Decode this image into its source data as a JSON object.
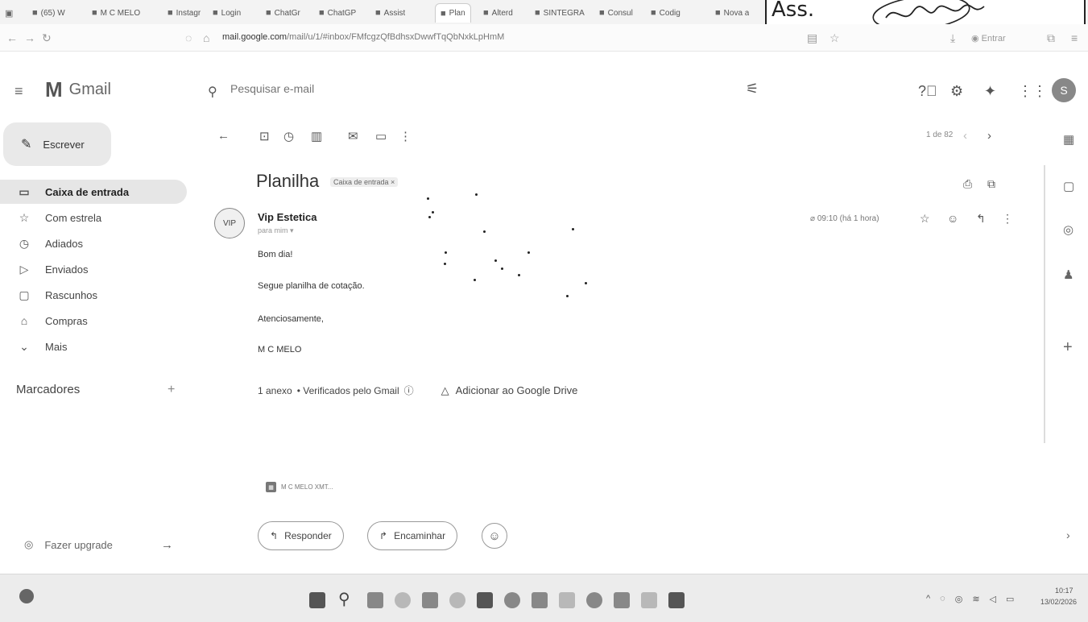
{
  "browser": {
    "tabs": [
      {
        "icon": "whatsapp-icon",
        "label": "(65) W"
      },
      {
        "icon": "page-icon",
        "label": "M C MELO"
      },
      {
        "icon": "instagram-icon",
        "label": "Instagr"
      },
      {
        "icon": "login-icon",
        "label": "Login"
      },
      {
        "icon": "chatgpt-icon",
        "label": "ChatGr"
      },
      {
        "icon": "chatgpt-icon",
        "label": "ChatGP"
      },
      {
        "icon": "assistant-icon",
        "label": "Assist"
      },
      {
        "icon": "gmail-icon",
        "label": "Plan"
      },
      {
        "icon": "page-icon",
        "label": "Alterd"
      },
      {
        "icon": "page-icon",
        "label": "SINTEGRA"
      },
      {
        "icon": "page-icon",
        "label": "Consul"
      },
      {
        "icon": "gmail-icon",
        "label": "Codig"
      },
      {
        "icon": "page-icon",
        "label": "Nova a"
      }
    ],
    "url_host": "mail.google.com",
    "url_path": "/mail/u/1/#inbox/FMfcgzQfBdhsxDwwfTqQbNxkLpHmM",
    "signin_label": "Entrar"
  },
  "stamp": {
    "label": "Ass."
  },
  "gmail": {
    "app_name": "Gmail",
    "search_placeholder": "Pesquisar e-mail",
    "avatar_letter": "S",
    "compose_label": "Escrever",
    "nav": [
      {
        "icon": "inbox-icon",
        "glyph": "▭",
        "label": "Caixa de entrada",
        "selected": true
      },
      {
        "icon": "star-icon",
        "glyph": "☆",
        "label": "Com estrela",
        "selected": false
      },
      {
        "icon": "clock-icon",
        "glyph": "◷",
        "label": "Adiados",
        "selected": false
      },
      {
        "icon": "send-icon",
        "glyph": "▷",
        "label": "Enviados",
        "selected": false
      },
      {
        "icon": "draft-icon",
        "glyph": "▢",
        "label": "Rascunhos",
        "selected": false
      },
      {
        "icon": "shopping-icon",
        "glyph": "⌂",
        "label": "Compras",
        "selected": false
      },
      {
        "icon": "chevron-down-icon",
        "glyph": "⌄",
        "label": "Mais",
        "selected": false
      }
    ],
    "labels_title": "Marcadores",
    "upgrade_label": "Fazer upgrade",
    "pager": "1 de 82",
    "message": {
      "subject": "Planilha",
      "inbox_badge": "Caixa de entrada ×",
      "sender_initials": "VIP",
      "sender_name": "Vip Estetica",
      "recipient": "para mim",
      "date": "09:10 (há 1 hora)",
      "body_lines": [
        "Bom dia!",
        "Segue planilha de cotação.",
        "Atenciosamente,",
        "M C MELO"
      ],
      "attachment_count": "1 anexo",
      "attachment_scan": "• Verificados pelo Gmail",
      "drive_label": "Adicionar ao Google Drive",
      "attachment_name": "M C MELO XMT..."
    },
    "reply_label": "Responder",
    "forward_label": "Encaminhar"
  },
  "taskbar": {
    "clock_time": "10:17",
    "clock_date": "13/02/2026"
  }
}
